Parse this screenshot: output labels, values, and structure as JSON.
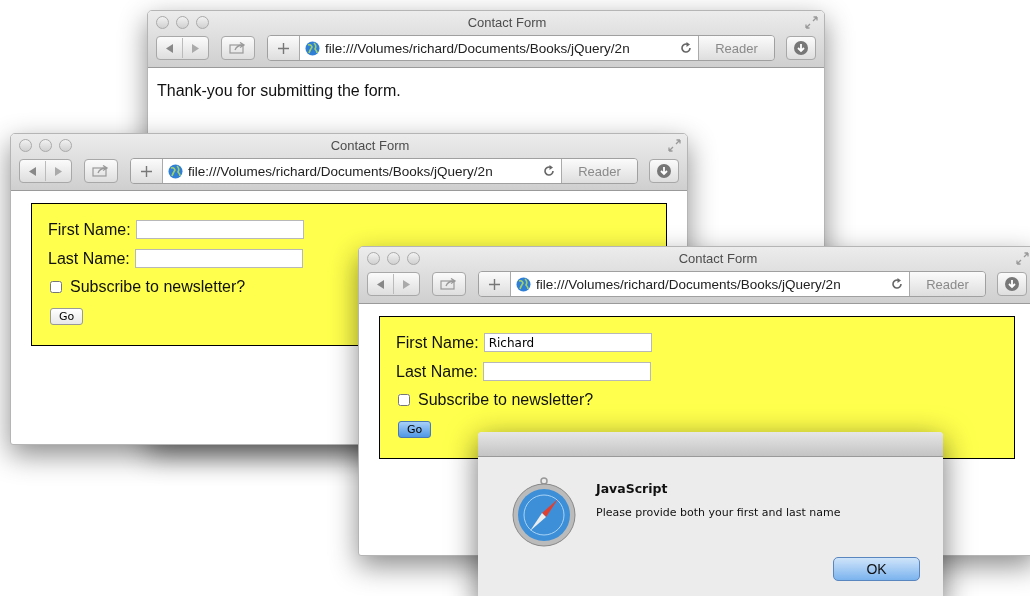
{
  "windows": [
    {
      "title": "Contact Form",
      "url": "file:///Volumes/richard/Documents/Books/jQuery/2n",
      "reader": {
        "label": "Reader",
        "disabled": true
      },
      "content": {
        "kind": "message",
        "text": "Thank-you for submitting the form."
      }
    },
    {
      "title": "Contact Form",
      "url": "file:///Volumes/richard/Documents/Books/jQuery/2n",
      "reader": {
        "label": "Reader",
        "disabled": true
      },
      "content": {
        "kind": "form",
        "fields": [
          {
            "label": "First Name:"
          },
          {
            "label": "Last Name:"
          }
        ],
        "checkbox": {
          "label": "Subscribe to newsletter?",
          "checked": false
        },
        "button": {
          "label": "Go",
          "default": false
        }
      }
    },
    {
      "title": "Contact Form",
      "url": "file:///Volumes/richard/Documents/Books/jQuery/2n",
      "reader": {
        "label": "Reader",
        "disabled": true
      },
      "content": {
        "kind": "form",
        "fields": [
          {
            "label": "First Name:",
            "value": "Richard"
          },
          {
            "label": "Last Name:"
          }
        ],
        "checkbox": {
          "label": "Subscribe to newsletter?",
          "checked": false
        },
        "button": {
          "label": "Go",
          "default": true
        }
      }
    }
  ],
  "dialog": {
    "title": "JavaScript",
    "message": "Please provide both your first and last name",
    "button": "OK"
  }
}
